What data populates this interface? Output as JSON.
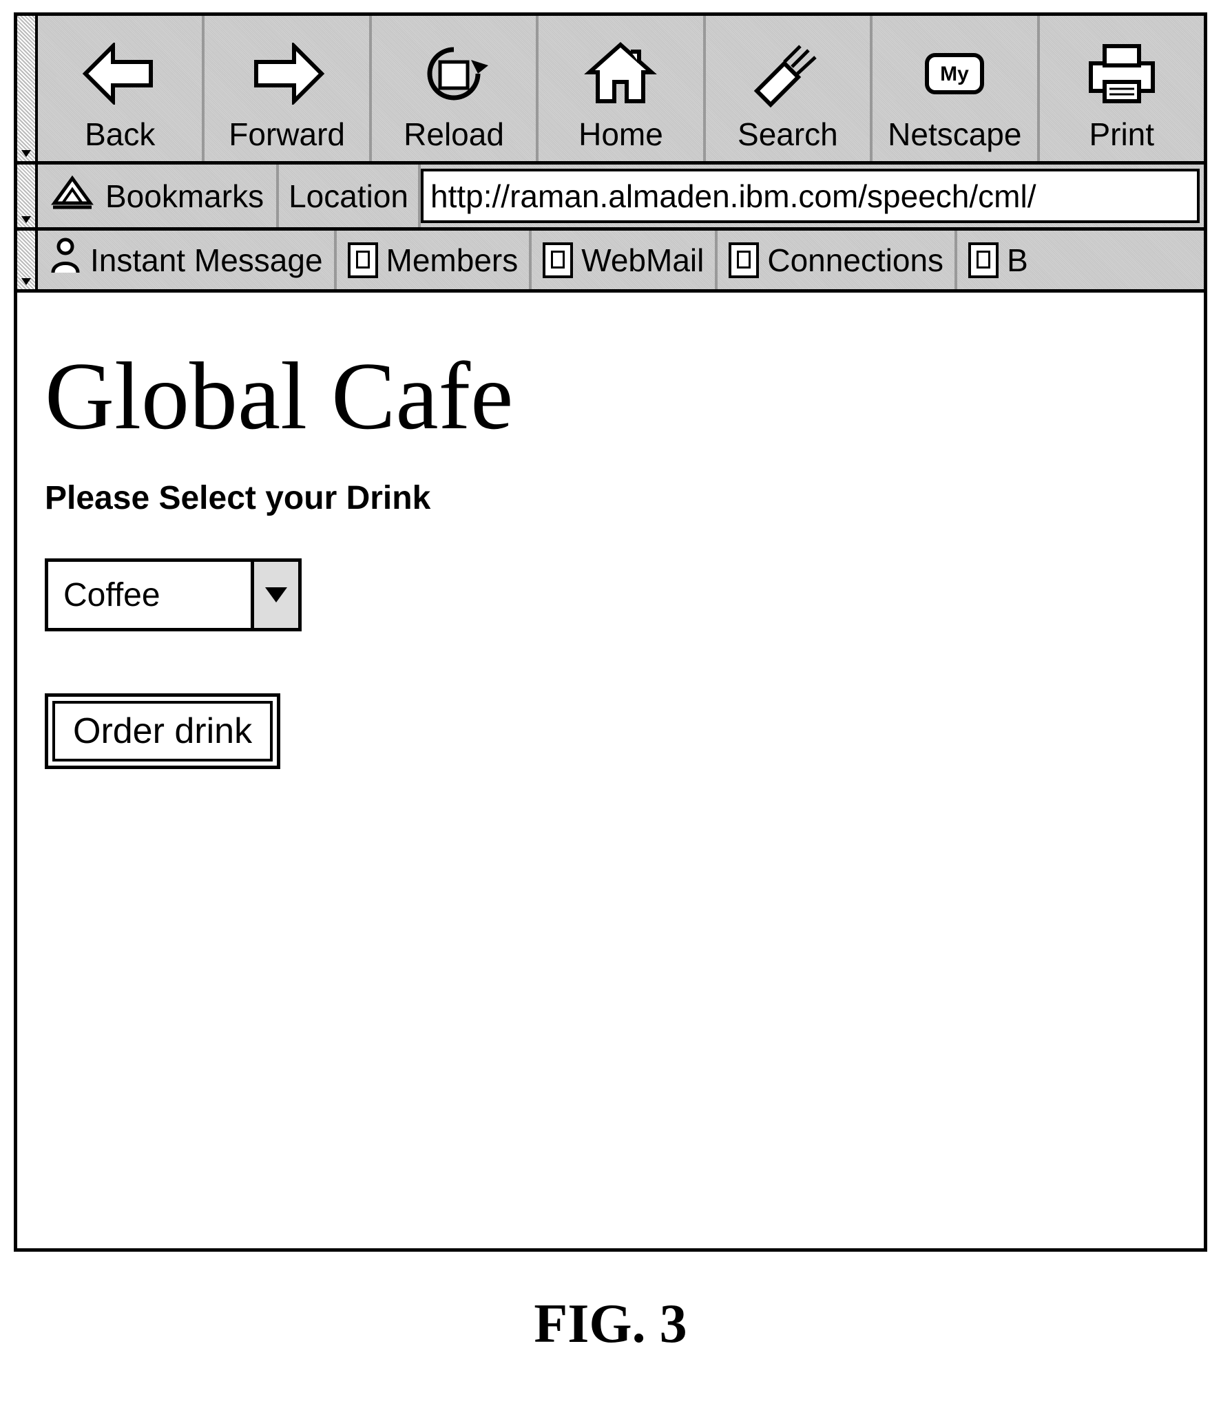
{
  "toolbar": {
    "items": [
      {
        "name": "back",
        "label": "Back"
      },
      {
        "name": "forward",
        "label": "Forward"
      },
      {
        "name": "reload",
        "label": "Reload"
      },
      {
        "name": "home",
        "label": "Home"
      },
      {
        "name": "search",
        "label": "Search"
      },
      {
        "name": "netscape",
        "label": "Netscape"
      },
      {
        "name": "print",
        "label": "Print"
      }
    ]
  },
  "location_bar": {
    "bookmarks_label": "Bookmarks",
    "location_label": "Location",
    "url": "http://raman.almaden.ibm.com/speech/cml/"
  },
  "personal_toolbar": {
    "items": [
      {
        "name": "instant-message",
        "label": "Instant Message"
      },
      {
        "name": "members",
        "label": "Members"
      },
      {
        "name": "webmail",
        "label": "WebMail"
      },
      {
        "name": "connections",
        "label": "Connections"
      },
      {
        "name": "b",
        "label": "B"
      }
    ]
  },
  "page": {
    "title": "Global Cafe",
    "prompt": "Please Select your Drink",
    "drink_selected": "Coffee",
    "order_button": "Order drink"
  },
  "figure_caption": "FIG. 3"
}
